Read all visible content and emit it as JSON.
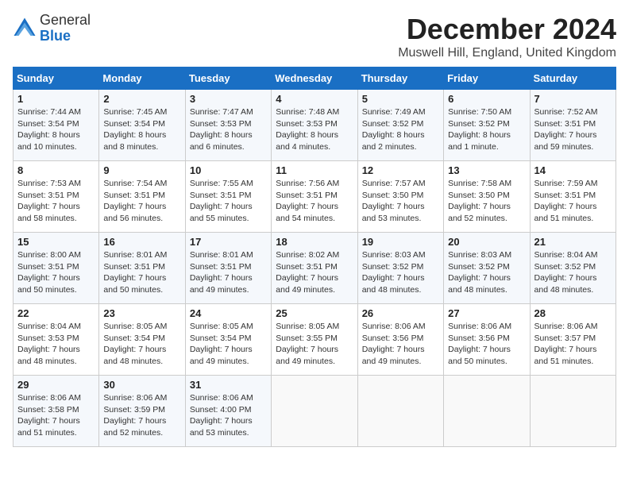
{
  "logo": {
    "general": "General",
    "blue": "Blue"
  },
  "header": {
    "month": "December 2024",
    "location": "Muswell Hill, England, United Kingdom"
  },
  "weekdays": [
    "Sunday",
    "Monday",
    "Tuesday",
    "Wednesday",
    "Thursday",
    "Friday",
    "Saturday"
  ],
  "weeks": [
    [
      {
        "day": "1",
        "sunrise": "7:44 AM",
        "sunset": "3:54 PM",
        "daylight": "8 hours and 10 minutes."
      },
      {
        "day": "2",
        "sunrise": "7:45 AM",
        "sunset": "3:54 PM",
        "daylight": "8 hours and 8 minutes."
      },
      {
        "day": "3",
        "sunrise": "7:47 AM",
        "sunset": "3:53 PM",
        "daylight": "8 hours and 6 minutes."
      },
      {
        "day": "4",
        "sunrise": "7:48 AM",
        "sunset": "3:53 PM",
        "daylight": "8 hours and 4 minutes."
      },
      {
        "day": "5",
        "sunrise": "7:49 AM",
        "sunset": "3:52 PM",
        "daylight": "8 hours and 2 minutes."
      },
      {
        "day": "6",
        "sunrise": "7:50 AM",
        "sunset": "3:52 PM",
        "daylight": "8 hours and 1 minute."
      },
      {
        "day": "7",
        "sunrise": "7:52 AM",
        "sunset": "3:51 PM",
        "daylight": "7 hours and 59 minutes."
      }
    ],
    [
      {
        "day": "8",
        "sunrise": "7:53 AM",
        "sunset": "3:51 PM",
        "daylight": "7 hours and 58 minutes."
      },
      {
        "day": "9",
        "sunrise": "7:54 AM",
        "sunset": "3:51 PM",
        "daylight": "7 hours and 56 minutes."
      },
      {
        "day": "10",
        "sunrise": "7:55 AM",
        "sunset": "3:51 PM",
        "daylight": "7 hours and 55 minutes."
      },
      {
        "day": "11",
        "sunrise": "7:56 AM",
        "sunset": "3:51 PM",
        "daylight": "7 hours and 54 minutes."
      },
      {
        "day": "12",
        "sunrise": "7:57 AM",
        "sunset": "3:50 PM",
        "daylight": "7 hours and 53 minutes."
      },
      {
        "day": "13",
        "sunrise": "7:58 AM",
        "sunset": "3:50 PM",
        "daylight": "7 hours and 52 minutes."
      },
      {
        "day": "14",
        "sunrise": "7:59 AM",
        "sunset": "3:51 PM",
        "daylight": "7 hours and 51 minutes."
      }
    ],
    [
      {
        "day": "15",
        "sunrise": "8:00 AM",
        "sunset": "3:51 PM",
        "daylight": "7 hours and 50 minutes."
      },
      {
        "day": "16",
        "sunrise": "8:01 AM",
        "sunset": "3:51 PM",
        "daylight": "7 hours and 50 minutes."
      },
      {
        "day": "17",
        "sunrise": "8:01 AM",
        "sunset": "3:51 PM",
        "daylight": "7 hours and 49 minutes."
      },
      {
        "day": "18",
        "sunrise": "8:02 AM",
        "sunset": "3:51 PM",
        "daylight": "7 hours and 49 minutes."
      },
      {
        "day": "19",
        "sunrise": "8:03 AM",
        "sunset": "3:52 PM",
        "daylight": "7 hours and 48 minutes."
      },
      {
        "day": "20",
        "sunrise": "8:03 AM",
        "sunset": "3:52 PM",
        "daylight": "7 hours and 48 minutes."
      },
      {
        "day": "21",
        "sunrise": "8:04 AM",
        "sunset": "3:52 PM",
        "daylight": "7 hours and 48 minutes."
      }
    ],
    [
      {
        "day": "22",
        "sunrise": "8:04 AM",
        "sunset": "3:53 PM",
        "daylight": "7 hours and 48 minutes."
      },
      {
        "day": "23",
        "sunrise": "8:05 AM",
        "sunset": "3:54 PM",
        "daylight": "7 hours and 48 minutes."
      },
      {
        "day": "24",
        "sunrise": "8:05 AM",
        "sunset": "3:54 PM",
        "daylight": "7 hours and 49 minutes."
      },
      {
        "day": "25",
        "sunrise": "8:05 AM",
        "sunset": "3:55 PM",
        "daylight": "7 hours and 49 minutes."
      },
      {
        "day": "26",
        "sunrise": "8:06 AM",
        "sunset": "3:56 PM",
        "daylight": "7 hours and 49 minutes."
      },
      {
        "day": "27",
        "sunrise": "8:06 AM",
        "sunset": "3:56 PM",
        "daylight": "7 hours and 50 minutes."
      },
      {
        "day": "28",
        "sunrise": "8:06 AM",
        "sunset": "3:57 PM",
        "daylight": "7 hours and 51 minutes."
      }
    ],
    [
      {
        "day": "29",
        "sunrise": "8:06 AM",
        "sunset": "3:58 PM",
        "daylight": "7 hours and 51 minutes."
      },
      {
        "day": "30",
        "sunrise": "8:06 AM",
        "sunset": "3:59 PM",
        "daylight": "7 hours and 52 minutes."
      },
      {
        "day": "31",
        "sunrise": "8:06 AM",
        "sunset": "4:00 PM",
        "daylight": "7 hours and 53 minutes."
      },
      null,
      null,
      null,
      null
    ]
  ]
}
